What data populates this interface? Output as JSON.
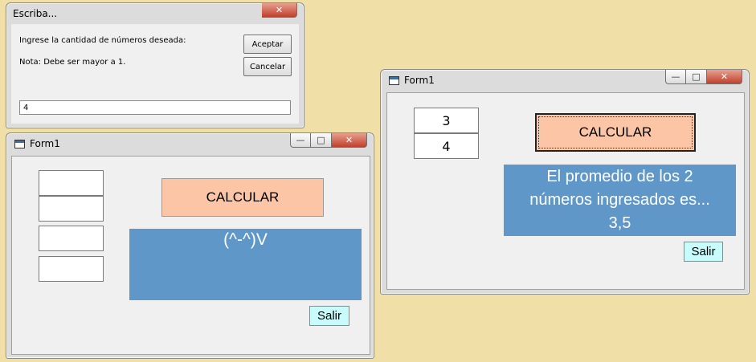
{
  "dialog": {
    "title": "Escriba...",
    "close_label": "✕",
    "prompt": "Ingrese la cantidad de números deseada:",
    "note": "Nota: Debe ser mayor a 1.",
    "ok_label": "Aceptar",
    "cancel_label": "Cancelar",
    "input_value": "4"
  },
  "form_left": {
    "title": "Form1",
    "textboxes": [
      "",
      "",
      "",
      ""
    ],
    "calc_label": "CALCULAR",
    "result_label": "(^-^)V",
    "exit_label": "Salir"
  },
  "form_right": {
    "title": "Form1",
    "textboxes": [
      "3",
      "4"
    ],
    "calc_label": "CALCULAR",
    "result_line1": "El promedio de los 2",
    "result_line2": "números ingresados es...",
    "result_line3": "3,5",
    "exit_label": "Salir"
  },
  "window_controls": {
    "minimize": "—",
    "maximize": "□",
    "close": "✕"
  },
  "colors": {
    "calc_button": "#fcc6a6",
    "result_panel": "#5f98c8",
    "exit_button": "#c8fcfc",
    "desktop": "#f0e0a8"
  }
}
